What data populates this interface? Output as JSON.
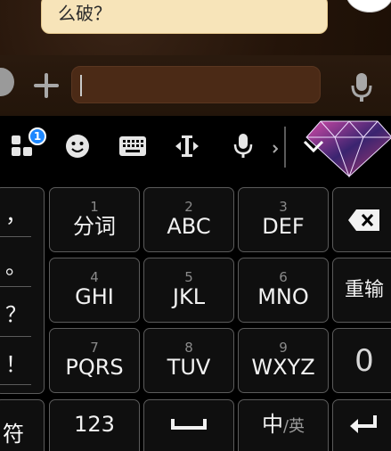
{
  "chat": {
    "bubble_text": "么破？"
  },
  "toolbar": {
    "badge_count": "1"
  },
  "keyboard": {
    "punctuation": [
      "，",
      "。",
      "？",
      "！"
    ],
    "keys": [
      {
        "num": "1",
        "label": "分词"
      },
      {
        "num": "2",
        "label": "ABC"
      },
      {
        "num": "3",
        "label": "DEF"
      },
      {
        "num": "4",
        "label": "GHI"
      },
      {
        "num": "5",
        "label": "JKL"
      },
      {
        "num": "6",
        "label": "MNO"
      },
      {
        "num": "7",
        "label": "PQRS"
      },
      {
        "num": "8",
        "label": "TUV"
      },
      {
        "num": "9",
        "label": "WXYZ"
      }
    ],
    "reenter": "重输",
    "zero": "0",
    "symbols": "符",
    "numbers": "123",
    "lang_main": "中",
    "lang_sub": "/英"
  }
}
